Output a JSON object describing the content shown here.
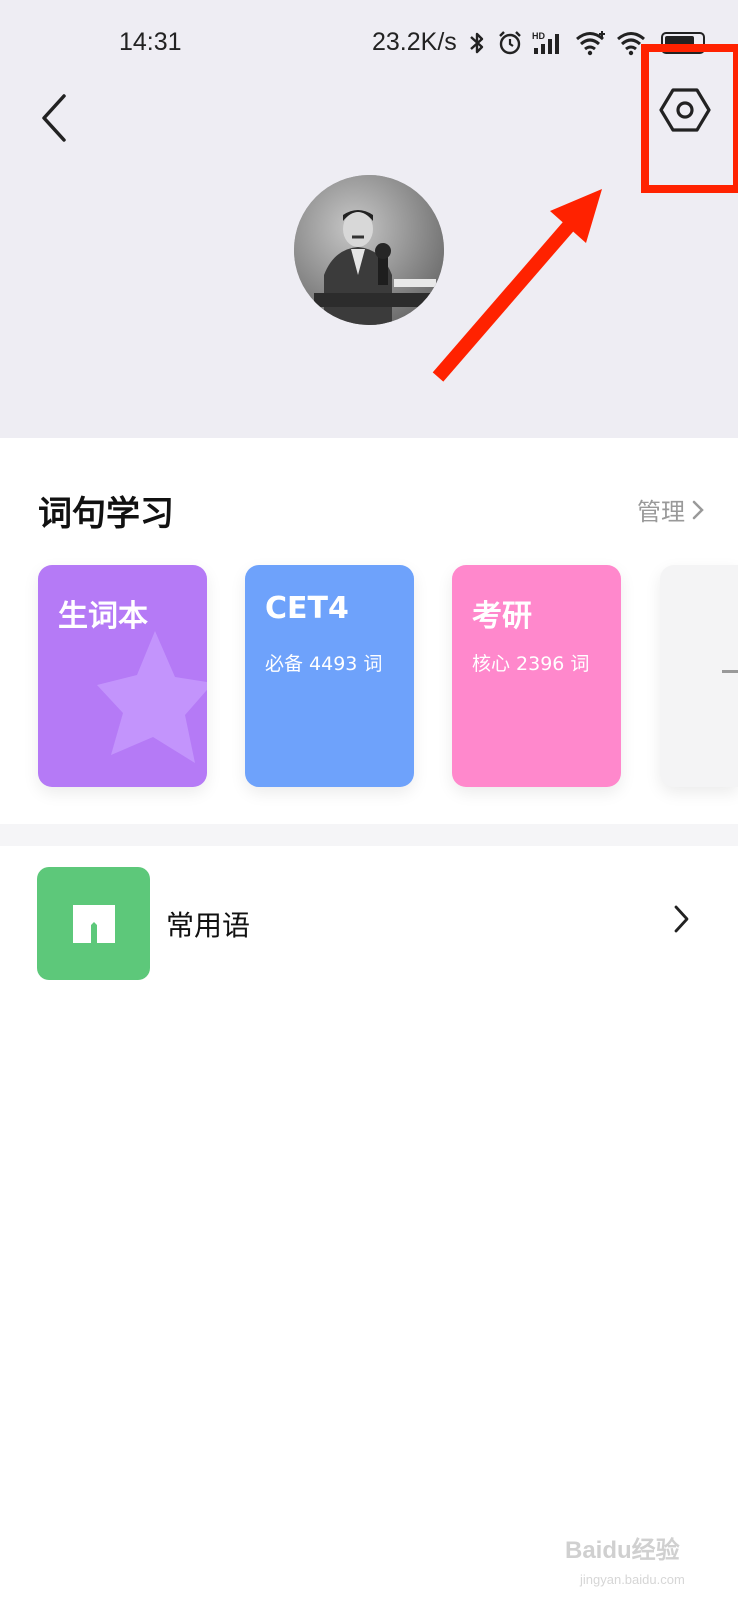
{
  "status_bar": {
    "time": "14:31",
    "net_speed": "23.2K/s",
    "battery_level": 0.85
  },
  "header": {
    "back_icon": "chevron-left-icon",
    "settings_icon": "hexagon-settings-icon",
    "avatar_icon": "user-avatar-photo"
  },
  "section": {
    "title": "词句学习",
    "manage_label": "管理",
    "cards": [
      {
        "title": "生词本",
        "subtitle": "",
        "color": "#b57af6"
      },
      {
        "title": "CET4",
        "subtitle": "必备 4493 词",
        "color": "#6ea2fb"
      },
      {
        "title": "考研",
        "subtitle": "核心 2396 词",
        "color": "#ff88cc"
      }
    ]
  },
  "list": {
    "items": [
      {
        "label": "常用语",
        "icon": "book-icon",
        "color": "#5dc87a"
      }
    ]
  },
  "annotation": {
    "color": "#ff2200"
  },
  "watermark": {
    "brand": "Baidu经验",
    "url": "jingyan.baidu.com"
  }
}
